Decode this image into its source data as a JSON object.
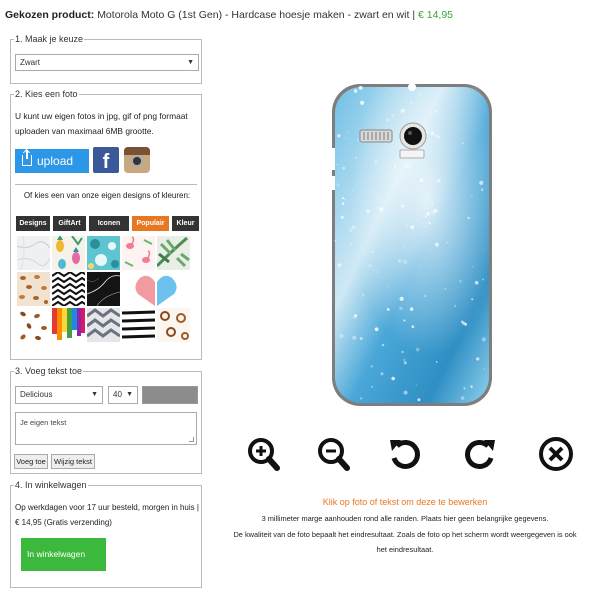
{
  "header": {
    "label": "Gekozen product:",
    "product": "Motorola Moto G (1st Gen) - Hardcase hoesje maken - zwart en wit",
    "separator": "|",
    "price": "€ 14,95"
  },
  "step1": {
    "title": "1. Maak je keuze",
    "select_value": "Zwart"
  },
  "step2": {
    "title": "2. Kies een foto",
    "intro": "U kunt uw eigen fotos in jpg, gif of png formaat uploaden van maximaal 6MB grootte.",
    "upload_label": "upload",
    "facebook_glyph": "f",
    "designs_intro": "Of kies een van onze eigen designs of kleuren:",
    "tabs": [
      "Designs",
      "GiftArt",
      "Iconen",
      "Populair",
      "Kleur"
    ],
    "active_tab": "Populair",
    "thumbnails": [
      "marble-white",
      "pineapples",
      "turquoise-pattern",
      "flamingos",
      "palm-leaves",
      "leopard-print",
      "zigzag-lines",
      "black-marble",
      "half-heart-pink",
      "half-heart-blue",
      "coffee-beans",
      "paint-drips",
      "chevron-grey",
      "brush-stripes",
      "coffee-cups"
    ]
  },
  "step3": {
    "title": "3. Voeg tekst toe",
    "font_value": "Delicious",
    "size_value": "40",
    "text_placeholder": "Je eigen tekst",
    "add_text_label": "Voeg toe",
    "edit_text_label": "Wijzig tekst",
    "text_color": "#8c8c8c"
  },
  "step4": {
    "title": "4. In winkelwagen",
    "info": "Op werkdagen voor 17 uur besteld, morgen in huis | € 14,95 (Gratis verzending)",
    "cart_label": "In winkelwagen"
  },
  "editor": {
    "icons": [
      "zoom-in-icon",
      "zoom-out-icon",
      "rotate-left-icon",
      "rotate-right-icon",
      "delete-icon"
    ],
    "edit_hint": "Klik op foto of tekst om deze te bewerken",
    "margin_note": "3 millimeter marge aanhouden rond alle randen. Plaats hier geen belangrijke gegevens.",
    "quality_note_1": "De kwaliteit van de foto bepaalt het eindresultaat. Zoals de foto op het scherm wordt weergegeven is ook",
    "quality_note_2": "het eindresultaat."
  },
  "colors": {
    "accent_orange": "#e87722",
    "price_green": "#3aa535",
    "upload_blue": "#2b97e6",
    "cart_green": "#3cb93c"
  }
}
